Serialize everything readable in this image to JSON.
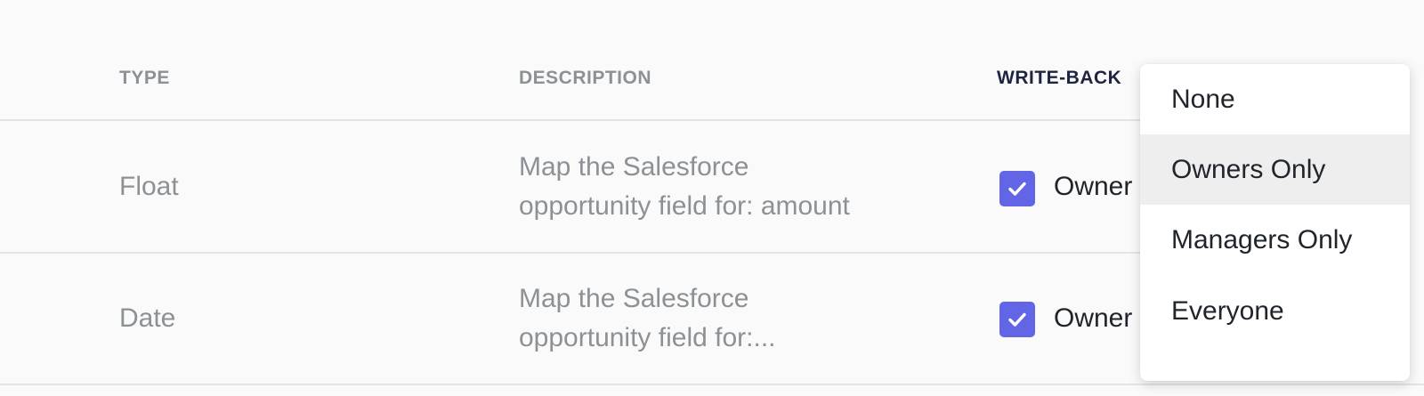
{
  "table": {
    "headers": {
      "type": "TYPE",
      "description": "DESCRIPTION",
      "write_back": "WRITE-BACK"
    },
    "rows": [
      {
        "type": "Float",
        "description_line1": "Map the Salesforce",
        "description_line2": "opportunity field for: amount",
        "write_back_checked": true,
        "write_back_value": "Owner"
      },
      {
        "type": "Date",
        "description_line1": "Map the Salesforce",
        "description_line2": "opportunity field for:...",
        "write_back_checked": true,
        "write_back_value": "Owner"
      }
    ]
  },
  "dropdown": {
    "options": [
      "None",
      "Owners Only",
      "Managers Only",
      "Everyone"
    ],
    "highlighted": "Owners Only"
  },
  "colors": {
    "accent": "#6266e6",
    "header_text": "#8c9196",
    "header_active": "#1f2540"
  },
  "icons": {
    "checkbox": "checkmark-icon"
  }
}
